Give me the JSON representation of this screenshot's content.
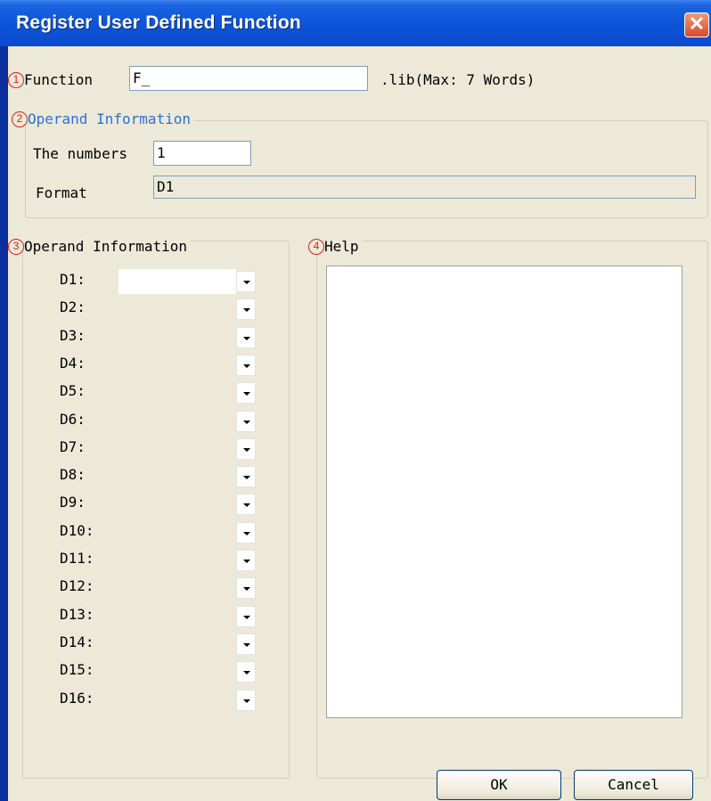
{
  "window": {
    "title": "Register User Defined Function",
    "close_glyph": "✕"
  },
  "function_row": {
    "marker": "1",
    "label": "Function",
    "value": "F_",
    "suffix": ".lib(Max: 7 Words)"
  },
  "operand_group_top": {
    "marker": "2",
    "title": "Operand Information",
    "numbers_label": "The numbers",
    "numbers_value": "1",
    "format_label": "Format",
    "format_value": "D1"
  },
  "operand_group_list": {
    "marker": "3",
    "title": "Operand Information",
    "items": [
      {
        "label": "D1:"
      },
      {
        "label": "D2:"
      },
      {
        "label": "D3:"
      },
      {
        "label": "D4:"
      },
      {
        "label": "D5:"
      },
      {
        "label": "D6:"
      },
      {
        "label": "D7:"
      },
      {
        "label": "D8:"
      },
      {
        "label": "D9:"
      },
      {
        "label": "D10:"
      },
      {
        "label": "D11:"
      },
      {
        "label": "D12:"
      },
      {
        "label": "D13:"
      },
      {
        "label": "D14:"
      },
      {
        "label": "D15:"
      },
      {
        "label": "D16:"
      }
    ]
  },
  "help_group": {
    "marker": "4",
    "title": "Help",
    "text": ""
  },
  "buttons": {
    "ok": "OK",
    "cancel": "Cancel"
  },
  "colors": {
    "title_bar": "#0d55d8",
    "dialog_bg": "#ece9d8",
    "marker_red": "#e02020",
    "group_title_blue": "#2f6fd6"
  }
}
